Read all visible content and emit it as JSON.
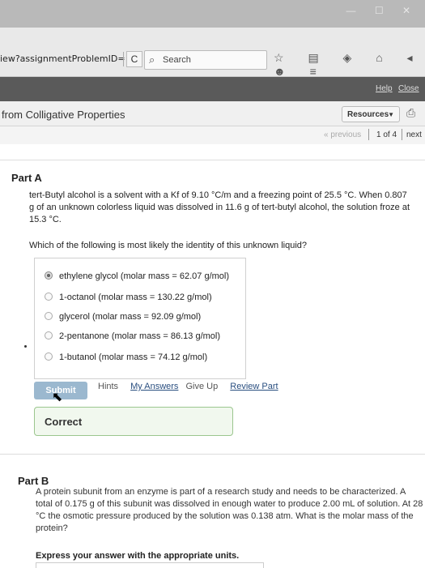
{
  "browser": {
    "url": "iew?assignmentProblemID=",
    "reload_icon": "C",
    "search_placeholder": "Search",
    "toolbar_icons": "☆ ▤ ◈ ⌂ ◂ ☻ ≡"
  },
  "header": {
    "help": "Help",
    "close": "Close",
    "title": "from Colligative Properties",
    "resources_label": "Resources",
    "pagination": {
      "previous": "« previous",
      "page": "1 of 4",
      "next": "next"
    }
  },
  "part_a": {
    "title": "Part A",
    "question": "tert-Butyl alcohol is a solvent with a Kf of 9.10 °C/m and a freezing point of 25.5 °C. When 0.807 g of an unknown colorless liquid was dissolved in 11.6 g of tert-butyl alcohol, the solution froze at 15.3 °C.",
    "ask": "Which of the following is most likely the identity of this unknown liquid?",
    "choices": [
      {
        "label": "ethylene glycol (molar mass = 62.07 g/mol)",
        "selected": true
      },
      {
        "label": "1-octanol (molar mass = 130.22 g/mol)",
        "selected": false
      },
      {
        "label": "glycerol (molar mass = 92.09 g/mol)",
        "selected": false
      },
      {
        "label": "2-pentanone (molar mass = 86.13 g/mol)",
        "selected": false
      },
      {
        "label": "1-butanol (molar mass = 74.12 g/mol)",
        "selected": false
      }
    ],
    "submit": "Submit",
    "hints": "Hints",
    "my_answers": "My Answers",
    "give_up": "Give Up",
    "review_part": "Review Part",
    "feedback": "Correct"
  },
  "part_b": {
    "title": "Part B",
    "question": "A protein subunit from an enzyme is part of a research study and needs to be characterized. A total of 0.175 g of this subunit was dissolved in enough water to produce 2.00 mL of solution. At 28 °C the osmotic pressure produced by the solution was 0.138 atm. What is the molar mass of the protein?",
    "instruction": "Express your answer with the appropriate units."
  }
}
